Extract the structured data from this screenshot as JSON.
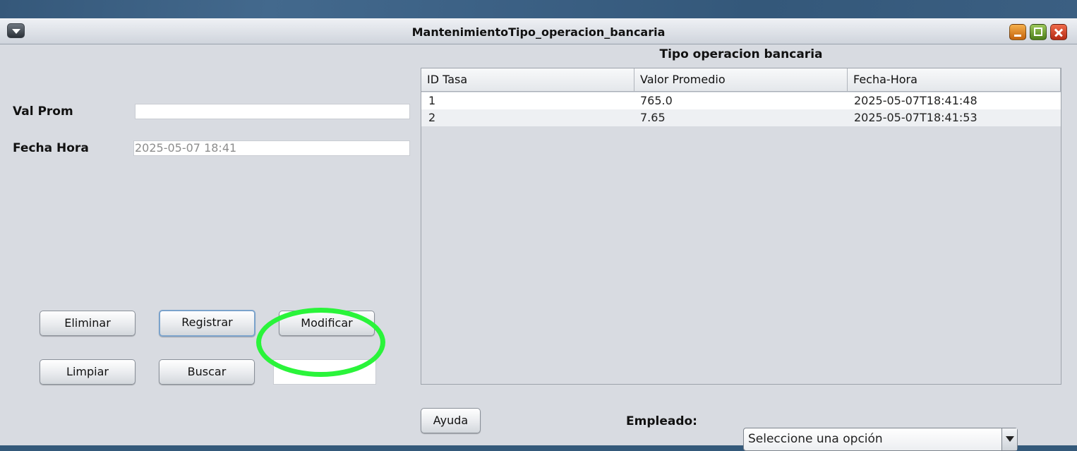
{
  "window": {
    "title": "MantenimientoTipo_operacion_bancaria"
  },
  "form": {
    "val_prom_label": "Val Prom",
    "val_prom_value": "",
    "fecha_hora_label": "Fecha Hora",
    "fecha_hora_value": "2025-05-07 18:41"
  },
  "buttons": {
    "eliminar": "Eliminar",
    "registrar": "Registrar",
    "modificar": "Modificar",
    "limpiar": "Limpiar",
    "buscar": "Buscar",
    "ayuda": "Ayuda"
  },
  "search": {
    "value": ""
  },
  "table": {
    "title": "Tipo operacion bancaria",
    "columns": [
      "ID Tasa",
      "Valor Promedio",
      "Fecha-Hora"
    ],
    "rows": [
      [
        "1",
        "765.0",
        "2025-05-07T18:41:48"
      ],
      [
        "2",
        "7.65",
        "2025-05-07T18:41:53"
      ]
    ]
  },
  "empleado": {
    "label": "Empleado:",
    "selected": "Seleccione una opción"
  },
  "icons": {
    "system_menu": "chevron-down-icon",
    "minimize": "minimize-icon",
    "maximize": "maximize-icon",
    "close": "close-icon",
    "dropdown": "dropdown-arrow-icon"
  },
  "colors": {
    "annotation": "#2af43a"
  }
}
